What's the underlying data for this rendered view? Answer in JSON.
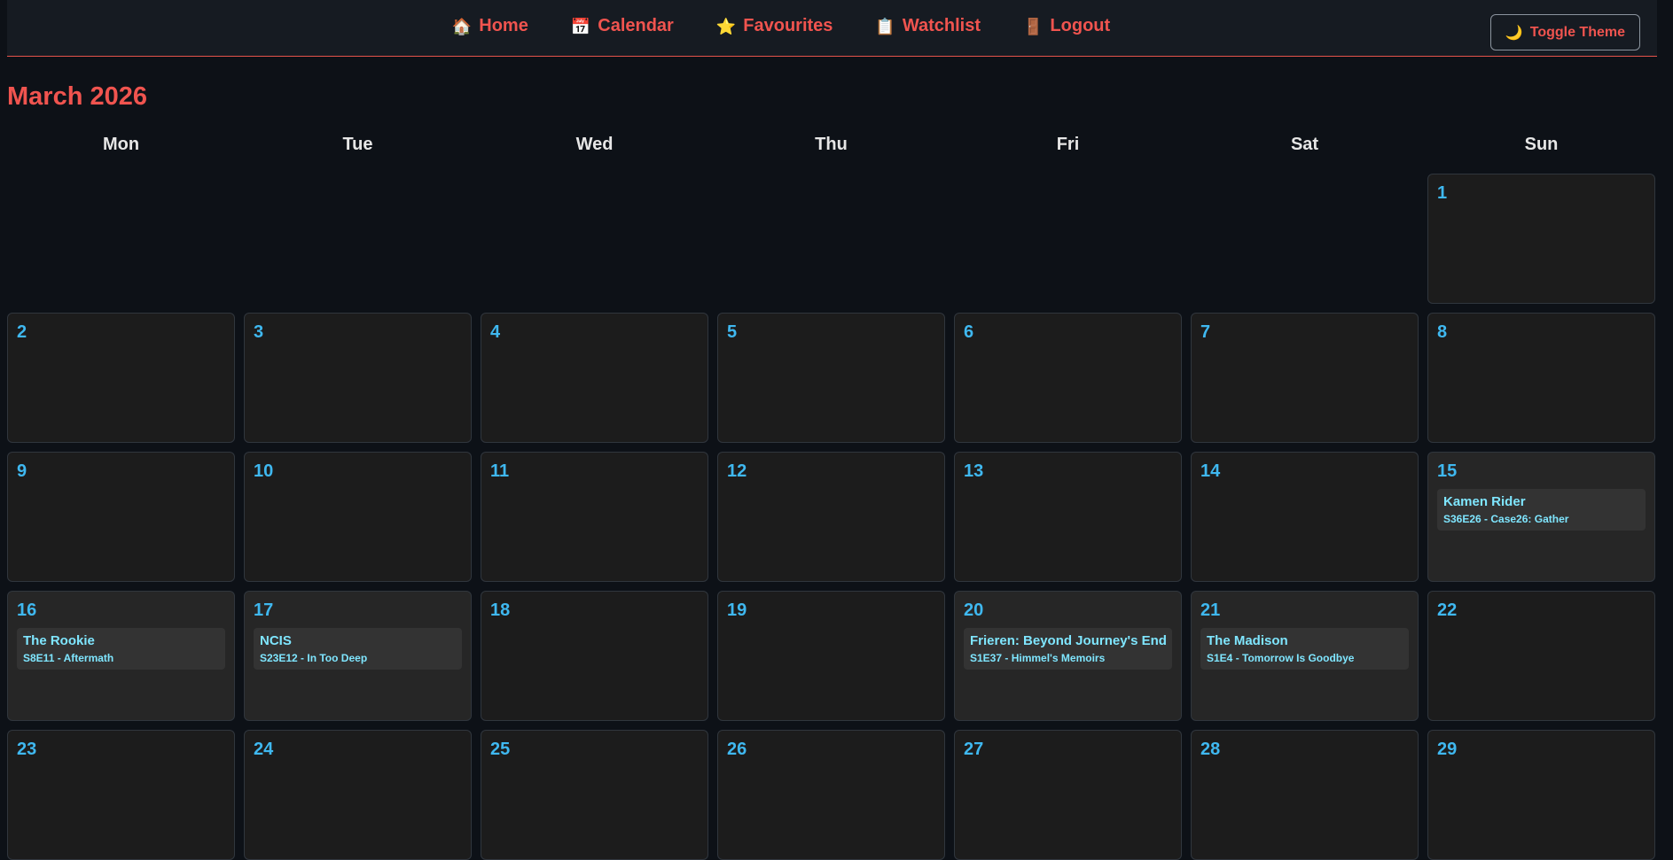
{
  "nav": {
    "links": [
      {
        "icon": "🏠",
        "label": "Home"
      },
      {
        "icon": "📅",
        "label": "Calendar"
      },
      {
        "icon": "⭐",
        "label": "Favourites"
      },
      {
        "icon": "📋",
        "label": "Watchlist"
      },
      {
        "icon": "🚪",
        "label": "Logout"
      }
    ],
    "toggle": {
      "icon": "🌙",
      "label": "Toggle Theme"
    }
  },
  "calendar": {
    "month_title": "March 2026",
    "weekdays": [
      "Mon",
      "Tue",
      "Wed",
      "Thu",
      "Fri",
      "Sat",
      "Sun"
    ],
    "leading_blanks": 6,
    "days": [
      {
        "num": "1"
      },
      {
        "num": "2"
      },
      {
        "num": "3"
      },
      {
        "num": "4"
      },
      {
        "num": "5"
      },
      {
        "num": "6"
      },
      {
        "num": "7"
      },
      {
        "num": "8"
      },
      {
        "num": "9"
      },
      {
        "num": "10"
      },
      {
        "num": "11"
      },
      {
        "num": "12"
      },
      {
        "num": "13"
      },
      {
        "num": "14"
      },
      {
        "num": "15",
        "event": {
          "show": "Kamen Rider",
          "episode": "S36E26 - Case26: Gather"
        }
      },
      {
        "num": "16",
        "event": {
          "show": "The Rookie",
          "episode": "S8E11 - Aftermath"
        }
      },
      {
        "num": "17",
        "event": {
          "show": "NCIS",
          "episode": "S23E12 - In Too Deep"
        }
      },
      {
        "num": "18"
      },
      {
        "num": "19"
      },
      {
        "num": "20",
        "event": {
          "show": "Frieren: Beyond Journey's End",
          "episode": "S1E37 - Himmel's Memoirs"
        }
      },
      {
        "num": "21",
        "event": {
          "show": "The Madison",
          "episode": "S1E4 - Tomorrow Is Goodbye"
        }
      },
      {
        "num": "22"
      },
      {
        "num": "23"
      },
      {
        "num": "24"
      },
      {
        "num": "25"
      },
      {
        "num": "26"
      },
      {
        "num": "27"
      },
      {
        "num": "28"
      },
      {
        "num": "29"
      }
    ]
  }
}
